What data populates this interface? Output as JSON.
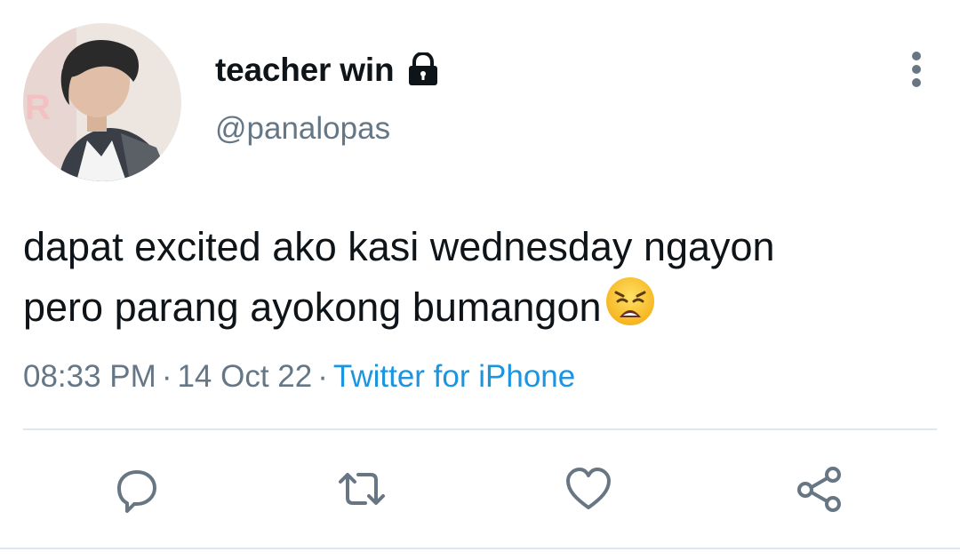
{
  "tweet": {
    "author": {
      "display_name": "teacher win",
      "handle": "@panalopas",
      "avatar_icon": "profile-photo",
      "protected_icon": "lock-icon"
    },
    "text_lines": [
      "dapat excited ako kasi wednesday ngayon",
      "pero parang ayokong bumangon"
    ],
    "emoji": "weary-face",
    "time": "08:33 PM",
    "date": "14 Oct 22",
    "separator": "·",
    "source": "Twitter for iPhone",
    "more_icon": "vertical-ellipsis-icon"
  },
  "actions": [
    {
      "name": "reply",
      "icon": "speech-bubble-icon"
    },
    {
      "name": "retweet",
      "icon": "retweet-arrows-icon"
    },
    {
      "name": "like",
      "icon": "heart-icon"
    },
    {
      "name": "share",
      "icon": "share-nodes-icon"
    }
  ],
  "colors": {
    "text": "#0f1419",
    "muted": "#657786",
    "link": "#1b95e0",
    "icon": "#687684",
    "divider": "#e1e8ed"
  }
}
